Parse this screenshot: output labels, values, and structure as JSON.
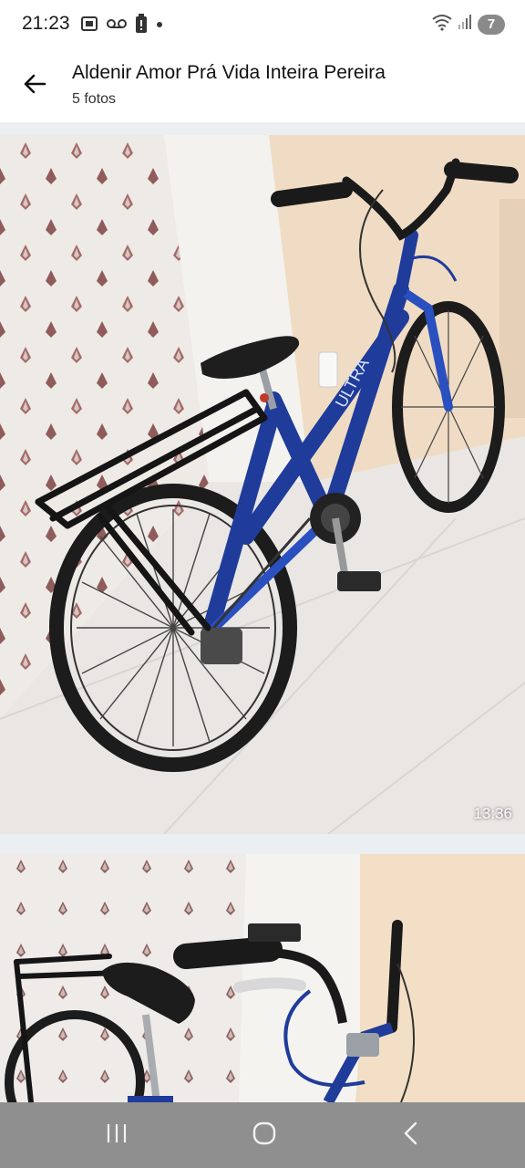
{
  "status_bar": {
    "time": "21:23",
    "icons_left": [
      "screenshot-icon",
      "voicemail-icon",
      "battery-alert-icon",
      "dot-icon"
    ],
    "icons_right": [
      "wifi-icon",
      "signal-icon"
    ],
    "notification_count": "7"
  },
  "header": {
    "back_icon": "arrow-left-icon",
    "title": "Aldenir Amor Prá Vida Inteira Pereira",
    "subtitle": "5 fotos"
  },
  "photos": [
    {
      "duration": "13:36"
    },
    {}
  ],
  "nav_bar": {
    "buttons": [
      "recents-icon",
      "home-icon",
      "back-icon"
    ]
  },
  "colors": {
    "bike_blue": "#1f3c9a",
    "nav_bar": "#8f8f8f",
    "separator": "#eceff1"
  }
}
